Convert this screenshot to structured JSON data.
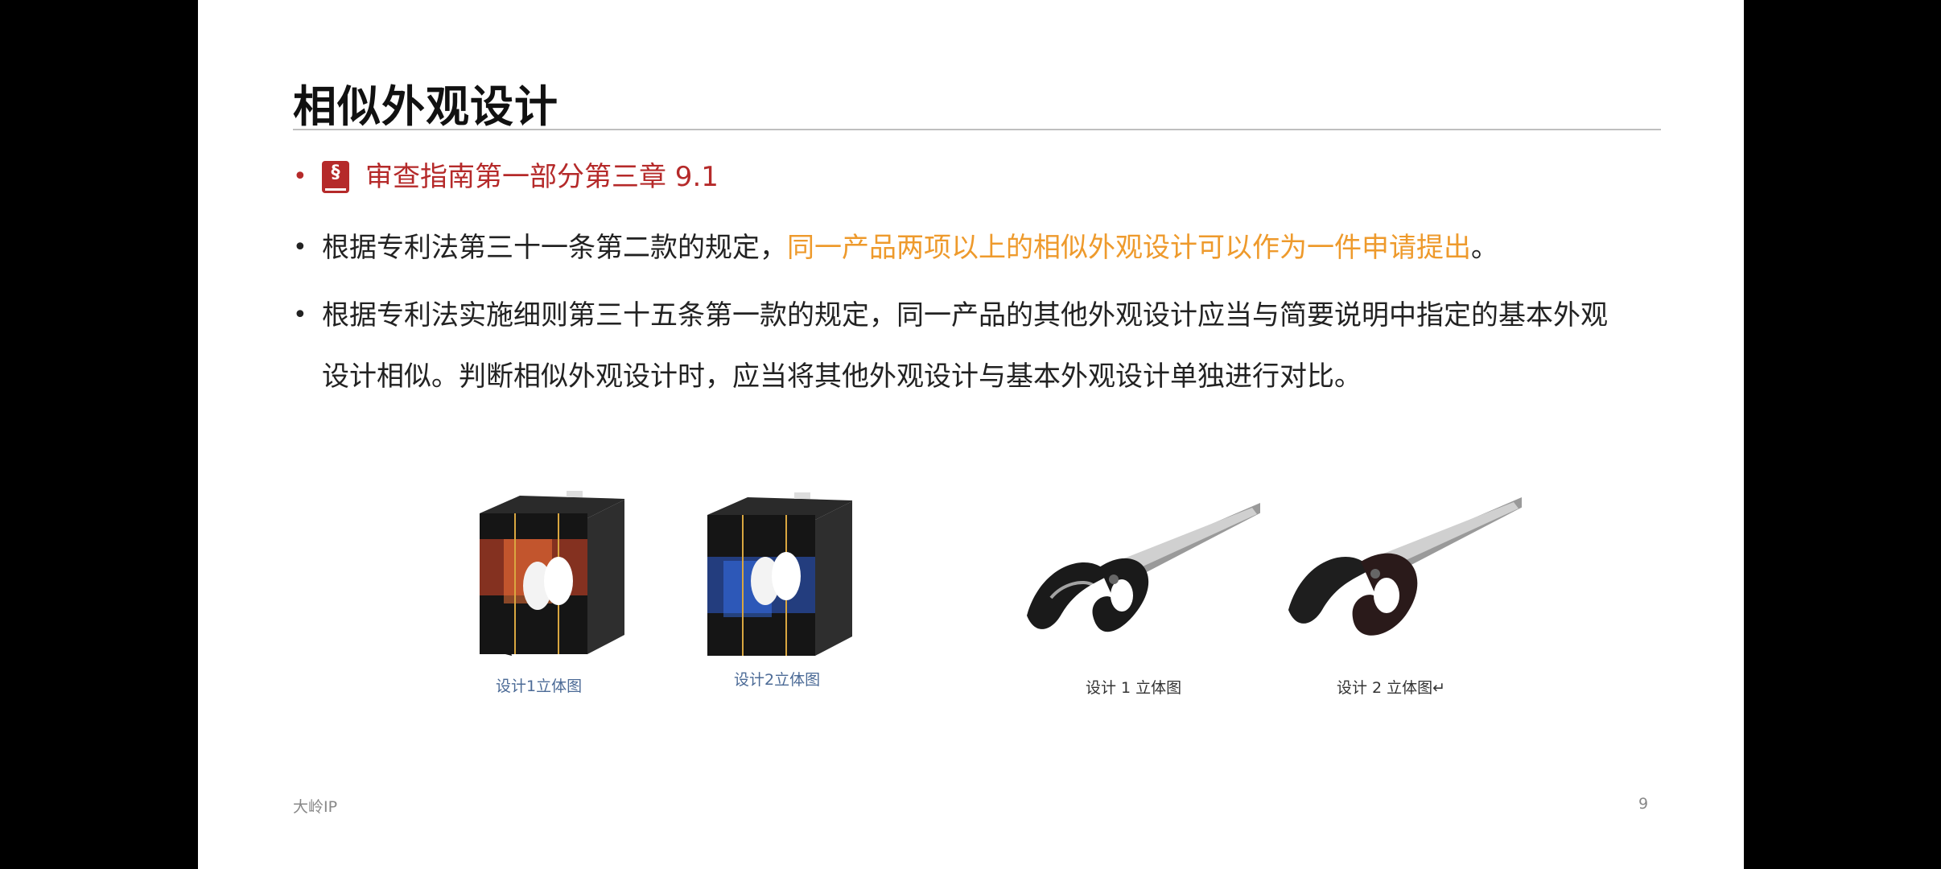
{
  "slide": {
    "title": "相似外观设计",
    "reference": {
      "icon": "law-book-icon",
      "text": "审查指南第一部分第三章 9.1"
    },
    "bullets": [
      {
        "before": "根据专利法第三十一条第二款的规定，",
        "highlight": "同一产品两项以上的相似外观设计可以作为一件申请提出",
        "after": "。"
      },
      {
        "text": "根据专利法实施细则第三十五条第一款的规定，同一产品的其他外观设计应当与简要说明中指定的基本外观设计相似。判断相似外观设计时，应当将其他外观设计与基本外观设计单独进行对比。"
      }
    ],
    "figures": [
      {
        "caption": "设计1立体图",
        "accent": "#e0482a"
      },
      {
        "caption": "设计2立体图",
        "accent": "#2f5fd6"
      },
      {
        "caption": "设计 1 立体图"
      },
      {
        "caption": "设计 2 立体图↵"
      }
    ],
    "footer": "大岭IP",
    "page_number": "9"
  },
  "colors": {
    "accent_red": "#b52a2a",
    "highlight_orange": "#ee9a2c",
    "caption_blue": "#4b6a96"
  }
}
